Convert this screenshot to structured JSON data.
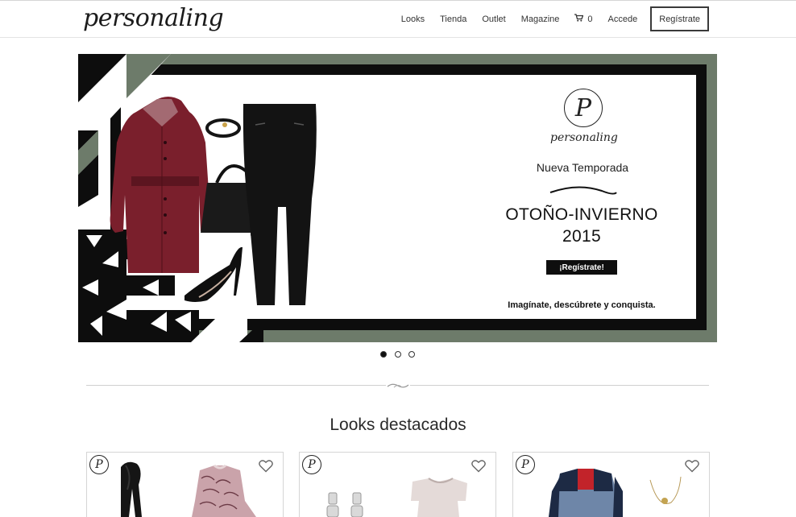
{
  "header": {
    "logo_text": "personaling",
    "nav": [
      {
        "label": "Looks"
      },
      {
        "label": "Tienda"
      },
      {
        "label": "Outlet"
      },
      {
        "label": "Magazine"
      },
      {
        "label": "0",
        "icon": "cart-icon"
      },
      {
        "label": "Accede"
      }
    ],
    "register_label": "Regístrate"
  },
  "hero": {
    "logo_letter": "P",
    "wordmark": "personaling",
    "season": "Nueva Temporada",
    "title_line1": "OTOÑO-INVIERNO",
    "title_line2": "2015",
    "cta": "¡Regístrate!",
    "tagline": "Imagínate, descúbrete y conquista.",
    "colors": {
      "frame": "#6d7b6a",
      "border": "#0d0d0d",
      "coat": "#7a1f2c"
    }
  },
  "carousel": {
    "slides": 3,
    "active_index": 0
  },
  "section": {
    "title": "Looks destacados"
  },
  "cards": [
    {
      "badge": "P",
      "icon": "heart-icon"
    },
    {
      "badge": "P",
      "icon": "heart-icon"
    },
    {
      "badge": "P",
      "icon": "heart-icon"
    }
  ]
}
